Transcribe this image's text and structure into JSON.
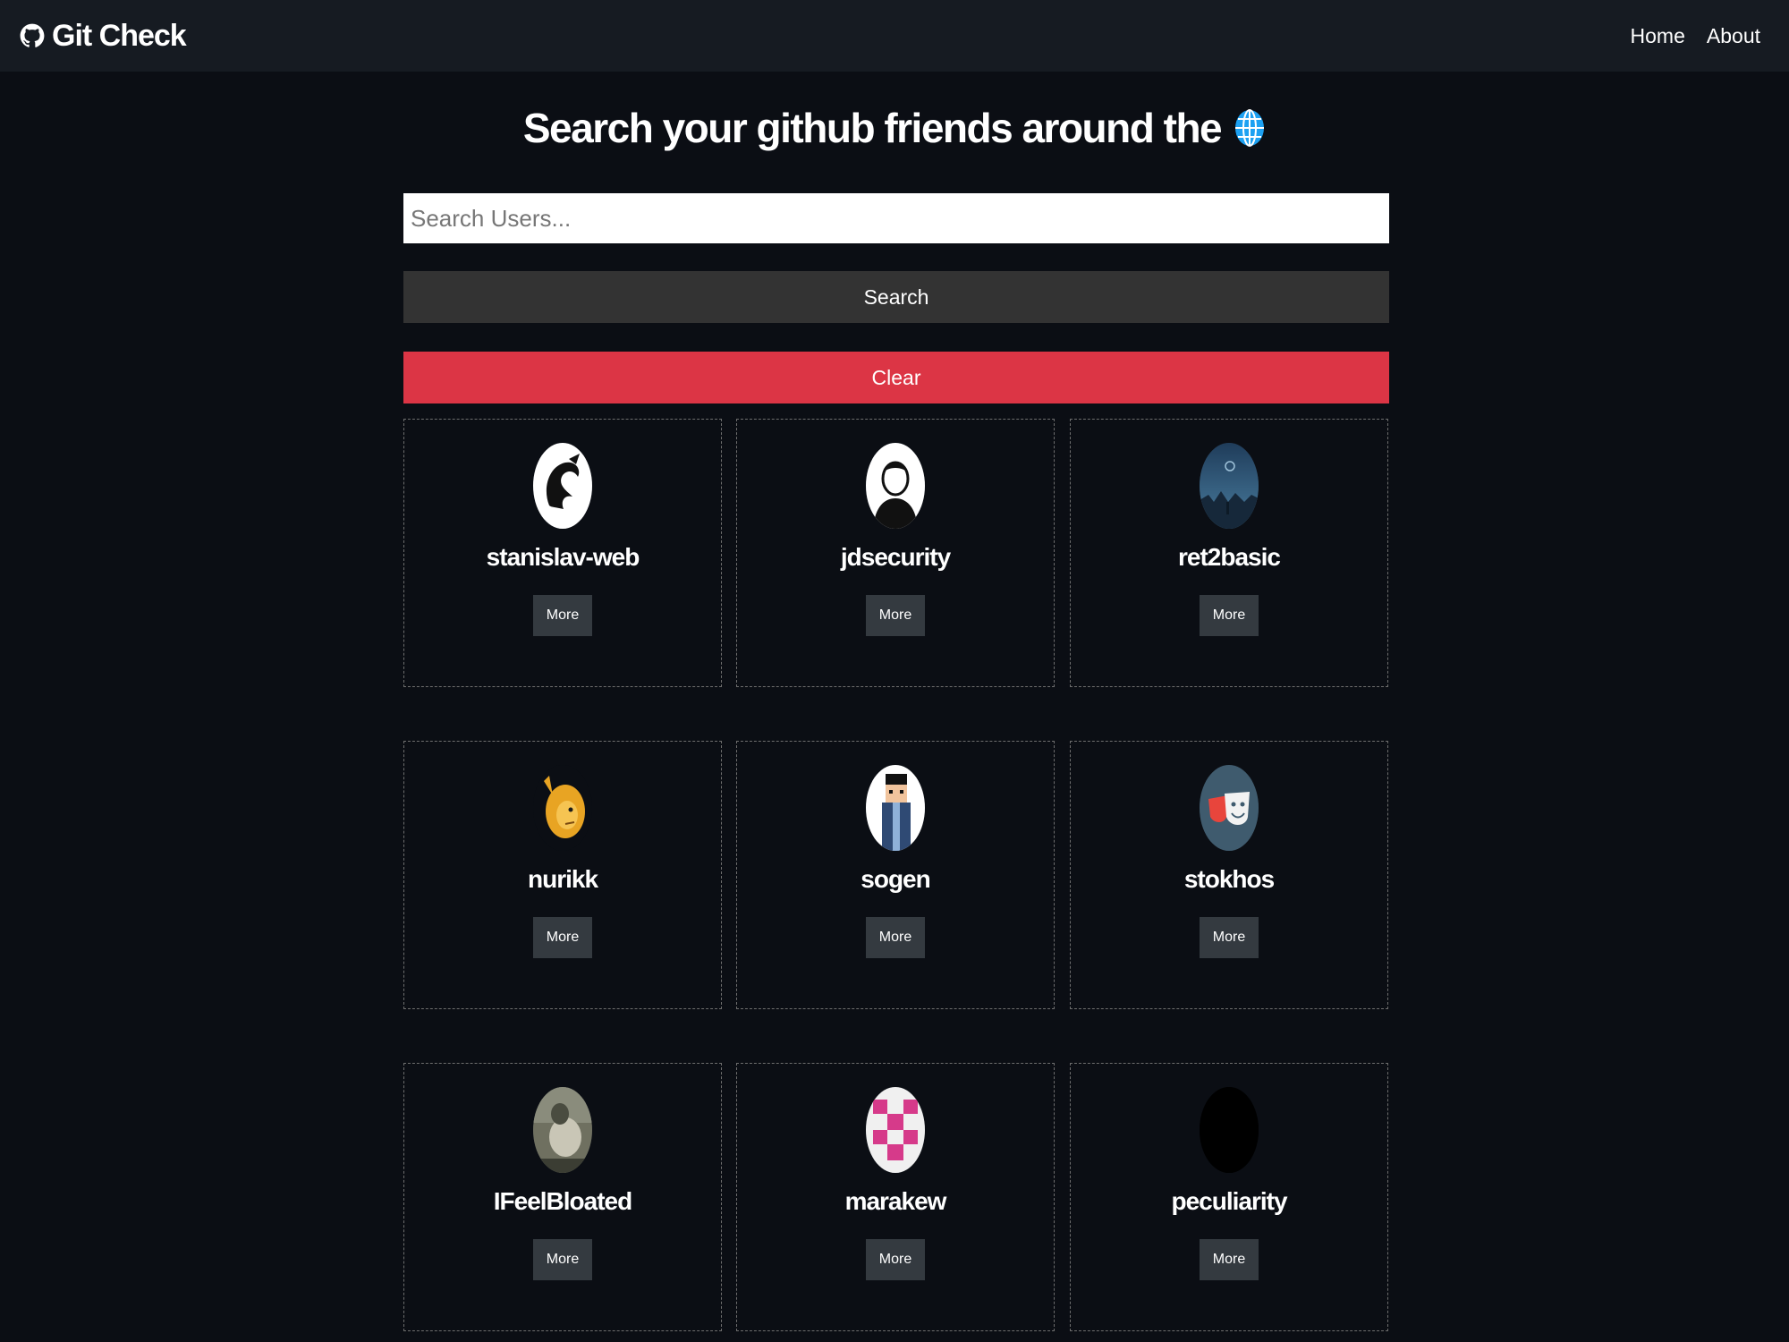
{
  "navbar": {
    "brand": "Git Check",
    "links": [
      "Home",
      "About"
    ]
  },
  "main": {
    "title": "Search your github friends around the",
    "search": {
      "placeholder": "Search Users...",
      "value": ""
    },
    "search_button": "Search",
    "clear_button": "Clear",
    "users": [
      {
        "login": "stanislav-web",
        "more_label": "More",
        "avatar_icon": "dragon-avatar"
      },
      {
        "login": "jdsecurity",
        "more_label": "More",
        "avatar_icon": "person-avatar"
      },
      {
        "login": "ret2basic",
        "more_label": "More",
        "avatar_icon": "night-scene-avatar"
      },
      {
        "login": "nurikk",
        "more_label": "More",
        "avatar_icon": "lion-avatar"
      },
      {
        "login": "sogen",
        "more_label": "More",
        "avatar_icon": "pixel-person-avatar"
      },
      {
        "login": "stokhos",
        "more_label": "More",
        "avatar_icon": "theater-masks-avatar"
      },
      {
        "login": "IFeelBloated",
        "more_label": "More",
        "avatar_icon": "photo-avatar"
      },
      {
        "login": "marakew",
        "more_label": "More",
        "avatar_icon": "identicon-avatar"
      },
      {
        "login": "peculiarity",
        "more_label": "More",
        "avatar_icon": "black-avatar"
      }
    ]
  },
  "colors": {
    "background": "#0b0e14",
    "navbar": "#161b22",
    "search_button": "#333333",
    "clear_button": "#dc3545",
    "more_button": "#343a40"
  }
}
